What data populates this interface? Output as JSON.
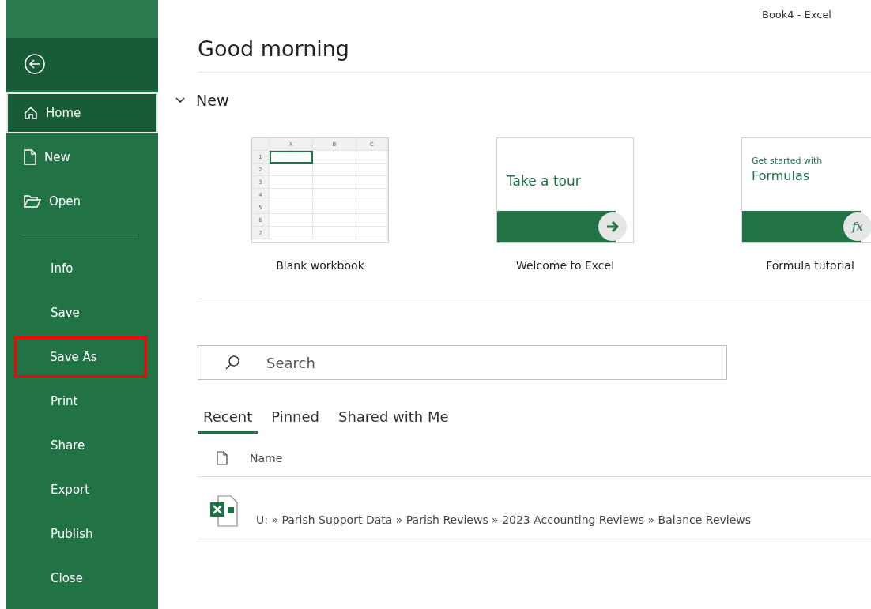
{
  "window": {
    "title": "Book4  -  Excel"
  },
  "sidebar": {
    "items": [
      {
        "kind": "primary",
        "label": "Home",
        "selected": true,
        "highlighted": false
      },
      {
        "kind": "primary",
        "label": "New",
        "selected": false,
        "highlighted": false
      },
      {
        "kind": "primary",
        "label": "Open",
        "selected": false,
        "highlighted": false
      },
      {
        "kind": "divider"
      },
      {
        "label": "Info",
        "selected": false,
        "highlighted": false
      },
      {
        "label": "Save",
        "selected": false,
        "highlighted": false
      },
      {
        "label": "Save As",
        "selected": false,
        "highlighted": true
      },
      {
        "label": "Print",
        "selected": false,
        "highlighted": false
      },
      {
        "label": "Share",
        "selected": false,
        "highlighted": false
      },
      {
        "label": "Export",
        "selected": false,
        "highlighted": false
      },
      {
        "label": "Publish",
        "selected": false,
        "highlighted": false
      },
      {
        "label": "Close",
        "selected": false,
        "highlighted": false
      }
    ]
  },
  "greeting": "Good morning",
  "new_section": {
    "title": "New",
    "expanded": true,
    "templates": [
      {
        "kind": "blank",
        "label": "Blank workbook",
        "columns": [
          "A",
          "B",
          "C"
        ],
        "rows": [
          "1",
          "2",
          "3",
          "4",
          "5",
          "6",
          "7"
        ]
      },
      {
        "kind": "tour",
        "label": "Welcome to Excel",
        "heading": "Take a tour"
      },
      {
        "kind": "formula",
        "label": "Formula tutorial",
        "subheading": "Get started with",
        "heading": "Formulas",
        "badge": "fx"
      }
    ]
  },
  "search": {
    "placeholder": "Search"
  },
  "tabs": [
    {
      "label": "Recent",
      "selected": true
    },
    {
      "label": "Pinned",
      "selected": false
    },
    {
      "label": "Shared with Me",
      "selected": false
    }
  ],
  "files": {
    "columns": [
      "Name"
    ],
    "rows": [
      {
        "path": "U: » Parish Support Data » Parish Reviews » 2023 Accounting Reviews » Balance Reviews"
      }
    ]
  }
}
